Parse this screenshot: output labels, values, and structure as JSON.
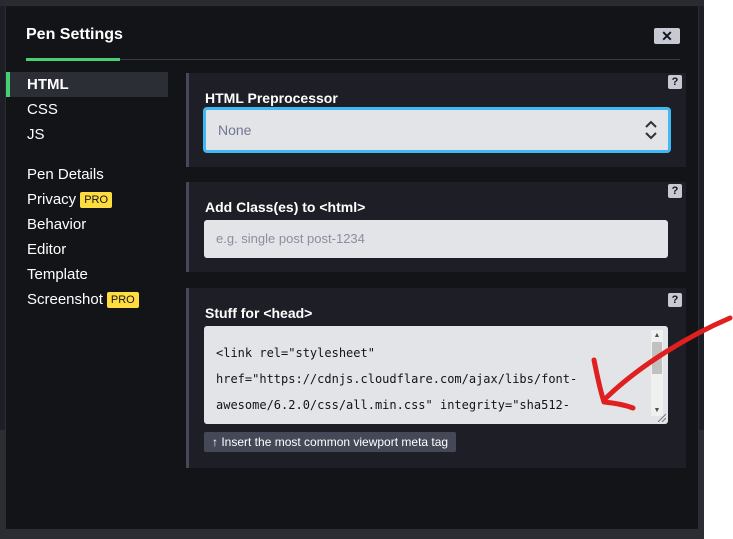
{
  "modal": {
    "title": "Pen Settings",
    "close_icon": "close-icon",
    "close_glyph": "✕"
  },
  "sidebar": {
    "items": [
      {
        "label": "HTML",
        "active": true
      },
      {
        "label": "CSS"
      },
      {
        "label": "JS"
      },
      {
        "label": "Pen Details"
      },
      {
        "label": "Privacy",
        "badge": "PRO"
      },
      {
        "label": "Behavior"
      },
      {
        "label": "Editor"
      },
      {
        "label": "Template"
      },
      {
        "label": "Screenshot",
        "badge": "PRO"
      }
    ]
  },
  "html_preprocessor": {
    "label": "HTML Preprocessor",
    "selected": "None",
    "help_icon": "question-icon",
    "help_glyph": "?"
  },
  "html_classes": {
    "label": "Add Class(es) to <html>",
    "placeholder": "e.g. single post post-1234",
    "help_glyph": "?"
  },
  "head_stuff": {
    "label": "Stuff for <head>",
    "help_glyph": "?",
    "lines": [
      "<link rel=\"stylesheet\"",
      "href=\"https://cdnjs.cloudflare.com/ajax/libs/font-",
      "awesome/6.2.0/css/all.min.css\" integrity=\"sha512-"
    ],
    "meta_button": "↑ Insert the most common viewport meta tag"
  },
  "colors": {
    "accent_green": "#47cf73",
    "focus_blue": "#3fb8f4",
    "pro_badge": "#ffdd40",
    "annotation_red": "#e02020"
  }
}
